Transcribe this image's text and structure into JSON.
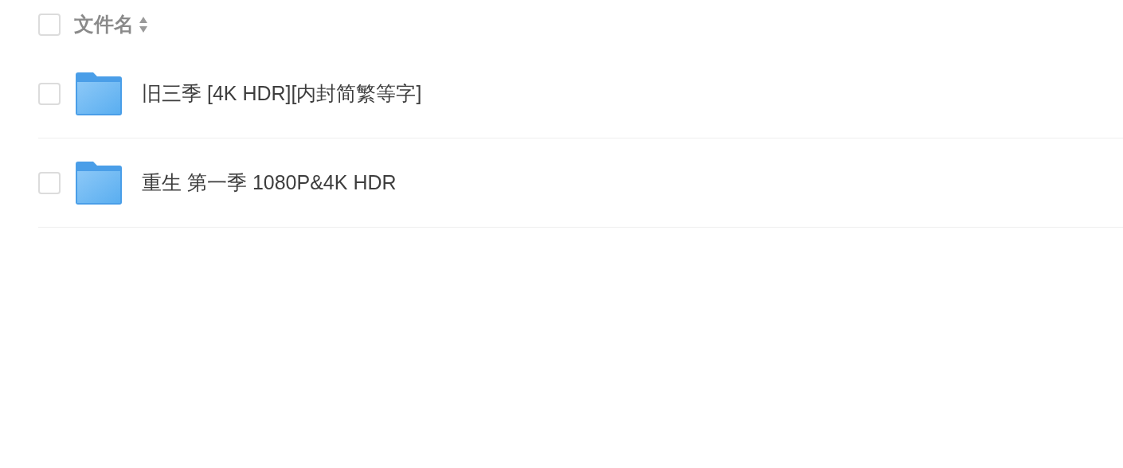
{
  "header": {
    "label": "文件名",
    "checked": false
  },
  "files": [
    {
      "name": "旧三季 [4K HDR][内封简繁等字]",
      "checked": false
    },
    {
      "name": "重生 第一季 1080P&4K HDR",
      "checked": false
    }
  ]
}
